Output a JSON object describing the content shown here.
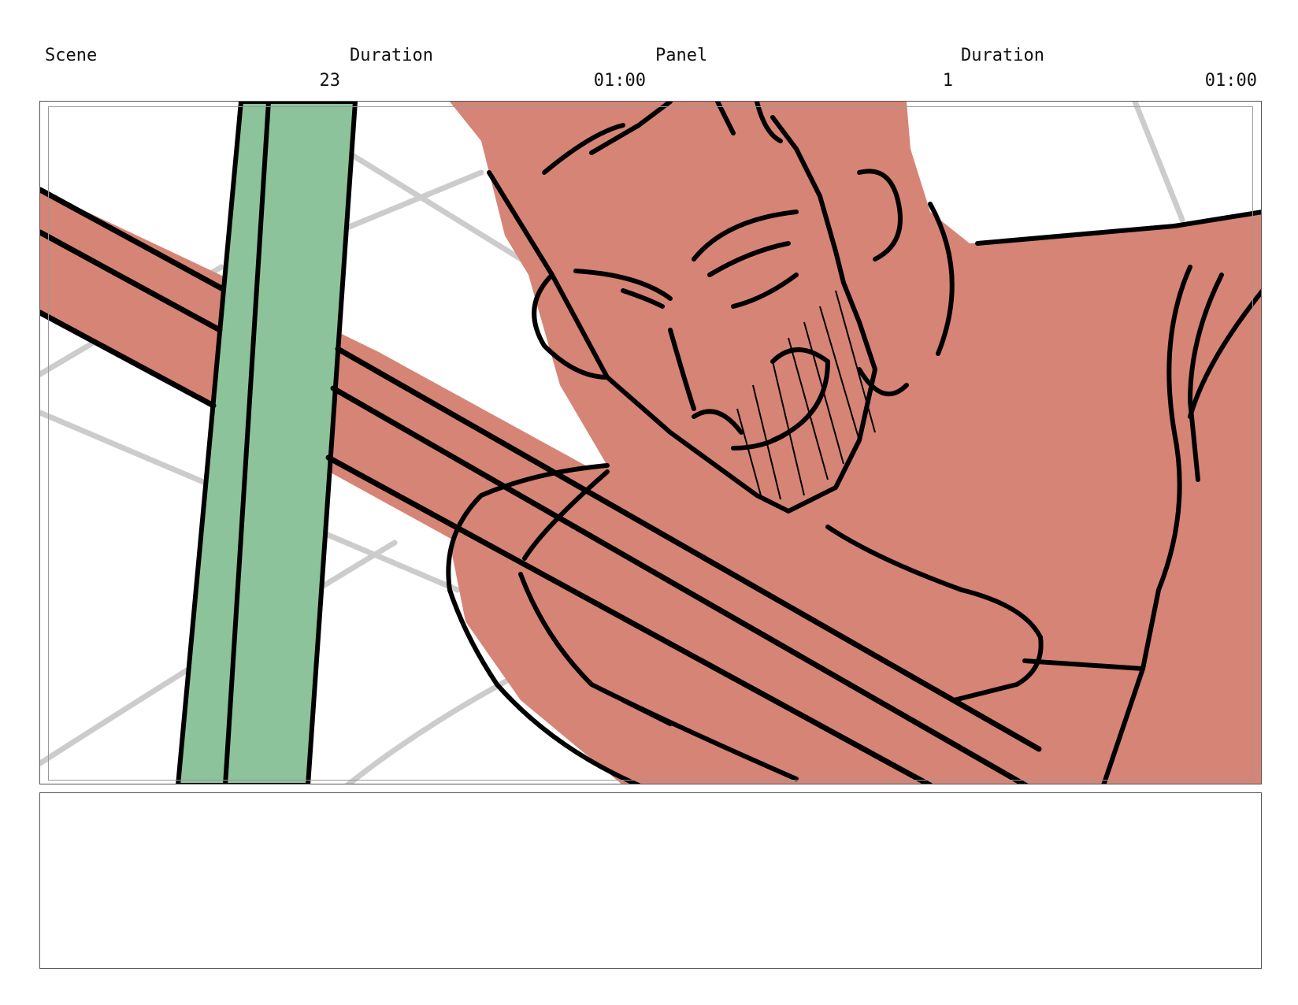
{
  "header": {
    "scene_label": "Scene",
    "scene_value": "23",
    "duration_label_1": "Duration",
    "duration_value_1": "01:00",
    "panel_label": "Panel",
    "panel_value": "1",
    "duration_label_2": "Duration",
    "duration_value_2": "01:00"
  },
  "colors": {
    "skin": "#d68476",
    "pole": "#8cc39b",
    "ink": "#000000",
    "guide": "#cccccc"
  },
  "notes": {
    "text": ""
  }
}
